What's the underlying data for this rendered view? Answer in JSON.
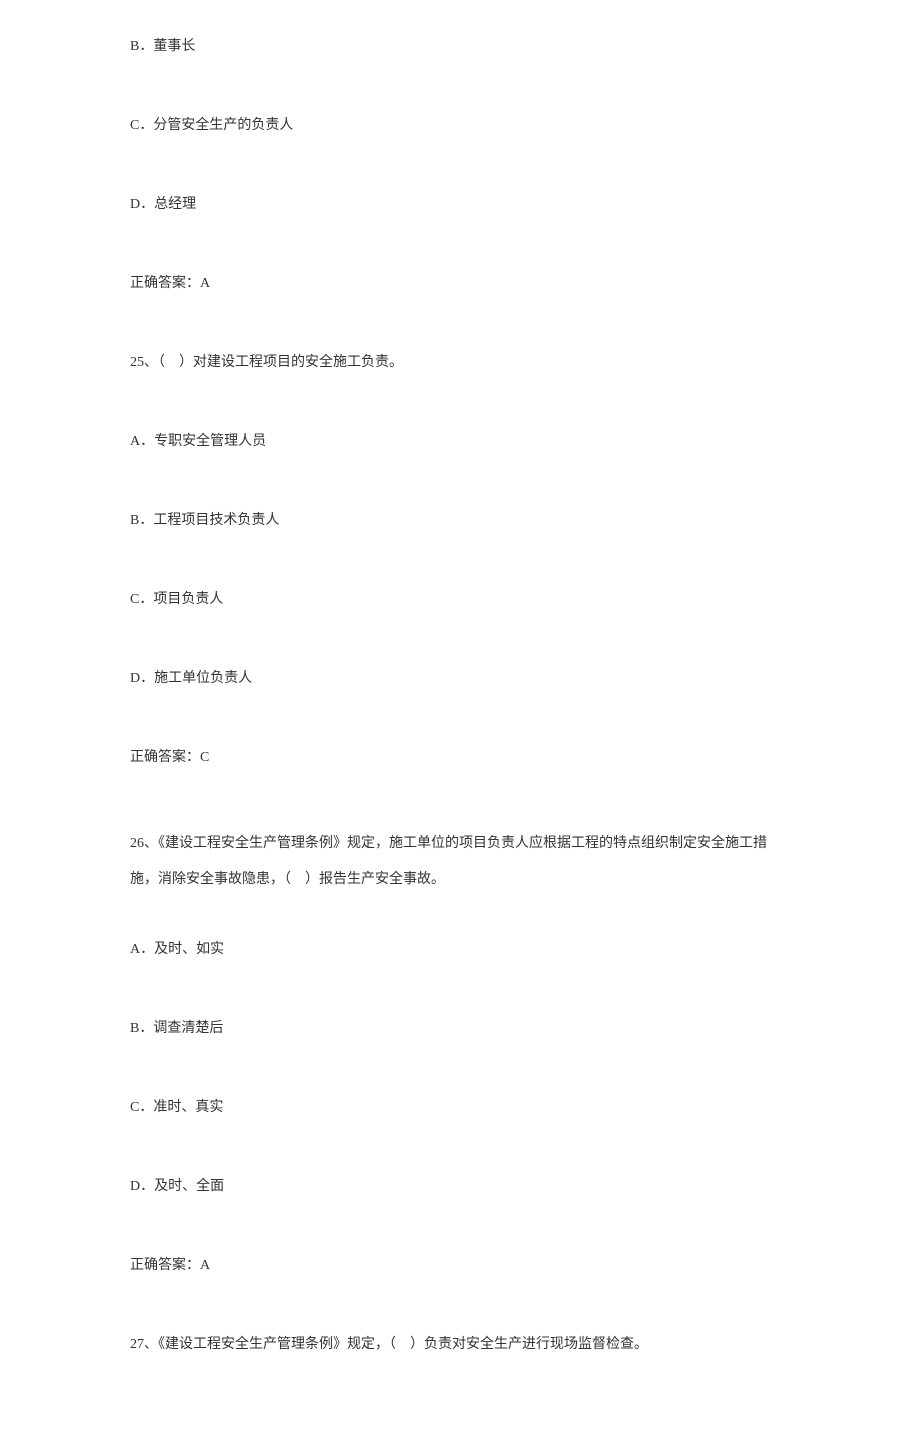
{
  "q24": {
    "option_b": "B．董事长",
    "option_c": "C．分管安全生产的负责人",
    "option_d": "D．总经理",
    "answer": "正确答案：A"
  },
  "q25": {
    "stem": "25、（　）对建设工程项目的安全施工负责。",
    "option_a": "A．专职安全管理人员",
    "option_b": "B．工程项目技术负责人",
    "option_c": "C．项目负责人",
    "option_d": "D．施工单位负责人",
    "answer": "正确答案：C"
  },
  "q26": {
    "stem": "26、《建设工程安全生产管理条例》规定，施工单位的项目负责人应根据工程的特点组织制定安全施工措施，消除安全事故隐患，（　）报告生产安全事故。",
    "option_a": "A．及时、如实",
    "option_b": "B．调查清楚后",
    "option_c": "C．准时、真实",
    "option_d": "D．及时、全面",
    "answer": "正确答案：A"
  },
  "q27": {
    "stem": "27、《建设工程安全生产管理条例》规定，（　）负责对安全生产进行现场监督检查。"
  }
}
